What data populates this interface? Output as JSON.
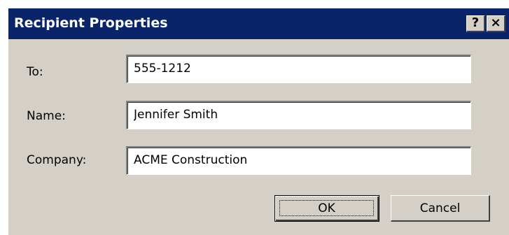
{
  "window": {
    "title": "Recipient Properties",
    "help_label": "?",
    "close_label": "×"
  },
  "form": {
    "to_label": "To:",
    "to_value": "555-1212",
    "name_label": "Name:",
    "name_value": "Jennifer Smith",
    "company_label": "Company:",
    "company_value": "ACME Construction"
  },
  "buttons": {
    "ok_label": "OK",
    "cancel_label": "Cancel"
  },
  "colors": {
    "titlebar": "#0a246a",
    "dialog_face": "#d4d0c8",
    "title_text": "#ffffff"
  },
  "icons": {
    "help": "help-icon",
    "close": "close-icon"
  }
}
